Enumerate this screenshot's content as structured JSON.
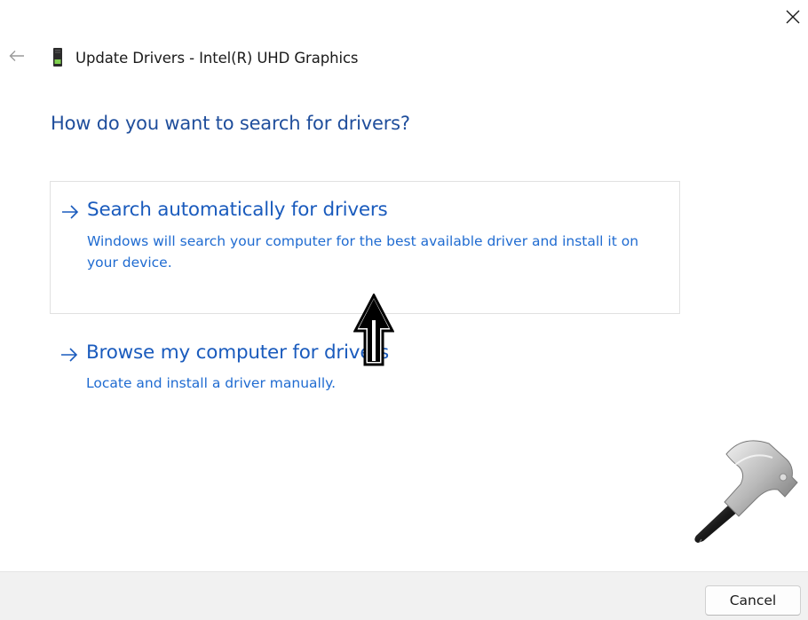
{
  "window": {
    "close_icon": "close-icon",
    "back_icon": "back-arrow-icon"
  },
  "header": {
    "device_icon": "display-adapter-icon",
    "title": "Update Drivers - Intel(R) UHD Graphics"
  },
  "main": {
    "question": "How do you want to search for drivers?",
    "options": [
      {
        "icon": "arrow-right-icon",
        "title": "Search automatically for drivers",
        "description": "Windows will search your computer for the best available driver and install it on your device."
      },
      {
        "icon": "arrow-right-icon",
        "title": "Browse my computer for drivers",
        "description": "Locate and install a driver manually."
      }
    ]
  },
  "overlay": {
    "annotation_icon": "up-arrow-annotation-icon",
    "logo_icon": "hammer-logo-icon"
  },
  "footer": {
    "cancel_label": "Cancel"
  },
  "colors": {
    "heading_blue": "#1f4e9c",
    "link_blue": "#1a5bbd",
    "desc_blue": "#1f6bd1",
    "footer_bg": "#f1f1f1",
    "card_border": "#e1e1e1"
  }
}
